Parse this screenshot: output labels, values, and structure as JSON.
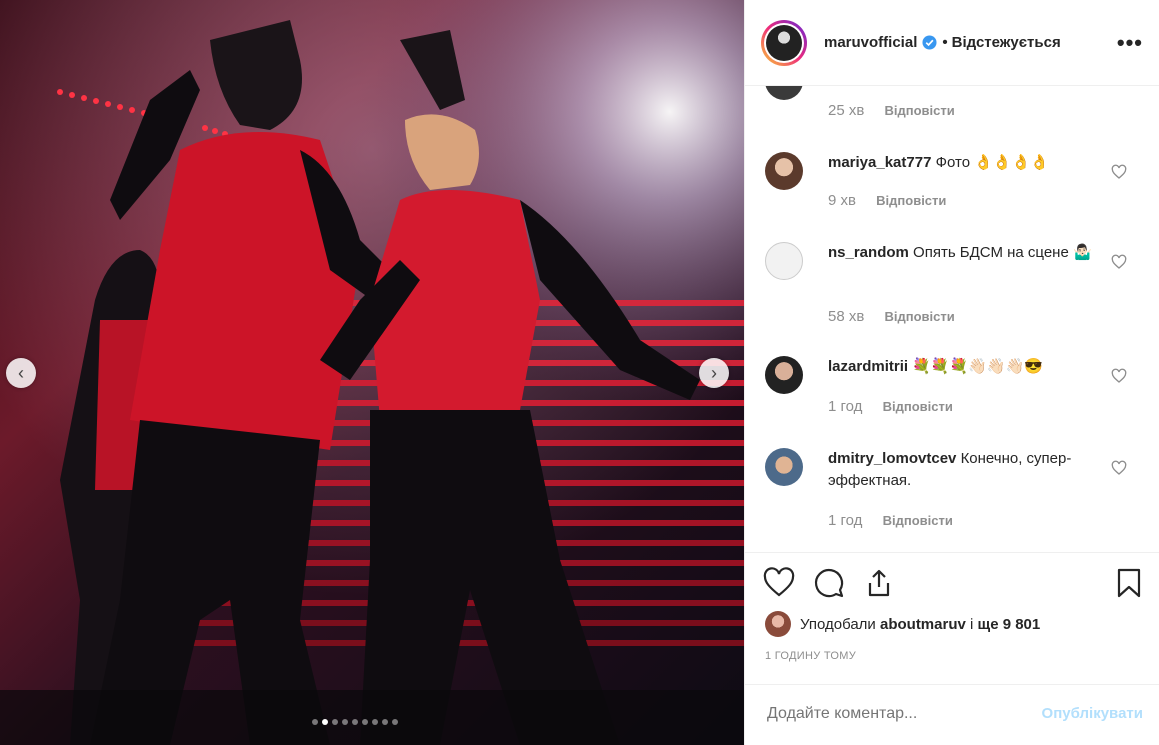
{
  "header": {
    "username": "maruvofficial",
    "separator": "•",
    "follow_status": "Відстежується",
    "more": "•••"
  },
  "carousel": {
    "slide_count": 9,
    "active_index": 1
  },
  "comments": [
    {
      "user": "",
      "text": "",
      "time": "25 хв",
      "reply": "Відповісти"
    },
    {
      "user": "mariya_kat777",
      "text": "Фото 👌👌👌👌",
      "time": "9 хв",
      "reply": "Відповісти"
    },
    {
      "user": "ns_random",
      "text": "Опять БДСМ на сцене 🤷🏻‍♂️",
      "time": "58 хв",
      "reply": "Відповісти"
    },
    {
      "user": "lazardmitrii",
      "text": "💐💐💐👋🏻👋🏻👋🏻😎",
      "time": "1 год",
      "reply": "Відповісти"
    },
    {
      "user": "dmitry_lomovtcev",
      "text": "Конечно, супер-эффектная.",
      "time": "1 год",
      "reply": "Відповісти"
    }
  ],
  "likes": {
    "prefix": "Уподобали",
    "user": "aboutmaruv",
    "connector": "і",
    "count": "ще 9 801"
  },
  "timestamp": "1 ГОДИНУ ТОМУ",
  "comment_box": {
    "placeholder": "Додайте коментар...",
    "post_label": "Опублікувати"
  },
  "colors": {
    "accent": "#3897f0",
    "post_disabled": "#b2dffc",
    "muted": "#8e8e8e"
  }
}
